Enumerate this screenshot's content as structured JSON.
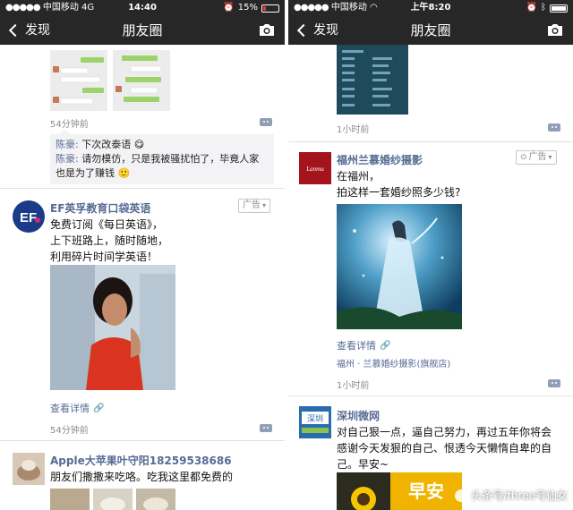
{
  "left": {
    "status": {
      "carrier": "中国移动",
      "network": "4G",
      "time": "14:40",
      "battery": "15%"
    },
    "nav": {
      "back_label": "发现",
      "title": "朋友圈"
    },
    "post1": {
      "time": "54分钟前",
      "comments": [
        {
          "author": "陈豪:",
          "text": "下次改泰语"
        },
        {
          "author": "陈豪:",
          "text": "请勿模仿，只是我被骚扰怕了，毕竟人家也是为了赚钱"
        }
      ]
    },
    "post2": {
      "author": "EF英孚教育口袋英语",
      "ad_label": "广告",
      "text": "免费订阅《每日英语》，\n上下班路上，随时随地，\n利用碎片时间学英语！",
      "detail_link": "查看详情",
      "time": "54分钟前"
    },
    "post3": {
      "author": "Apple大苹果叶守阳18259538686",
      "text": "朋友们撒撒来吃咯。吃我这里都免费的"
    }
  },
  "right": {
    "status": {
      "carrier": "中国移动",
      "time": "上午8:20"
    },
    "nav": {
      "back_label": "发现",
      "title": "朋友圈"
    },
    "post1": {
      "time": "1小时前"
    },
    "post2": {
      "author": "福州兰慕婚纱摄影",
      "logo_text": "Lanmu",
      "ad_label": "广告",
      "text": "在福州，\n拍这样一套婚纱照多少钱?",
      "detail_link": "查看详情",
      "location": "福州 · 兰慕婚纱摄影(旗舰店)",
      "time": "1小时前"
    },
    "post3": {
      "author": "深圳微网",
      "avatar_text": "深圳",
      "text": "对自己狠一点，逼自己努力，再过五年你将会感谢今天发狠的自己、恨透今天懒惰自卑的自己。早安~",
      "image_text": "早安",
      "watermark": "头条号/three号仙女"
    }
  },
  "colors": {
    "nav_bg": "#272727",
    "link": "#576b95",
    "meta": "#8c8c8c"
  }
}
